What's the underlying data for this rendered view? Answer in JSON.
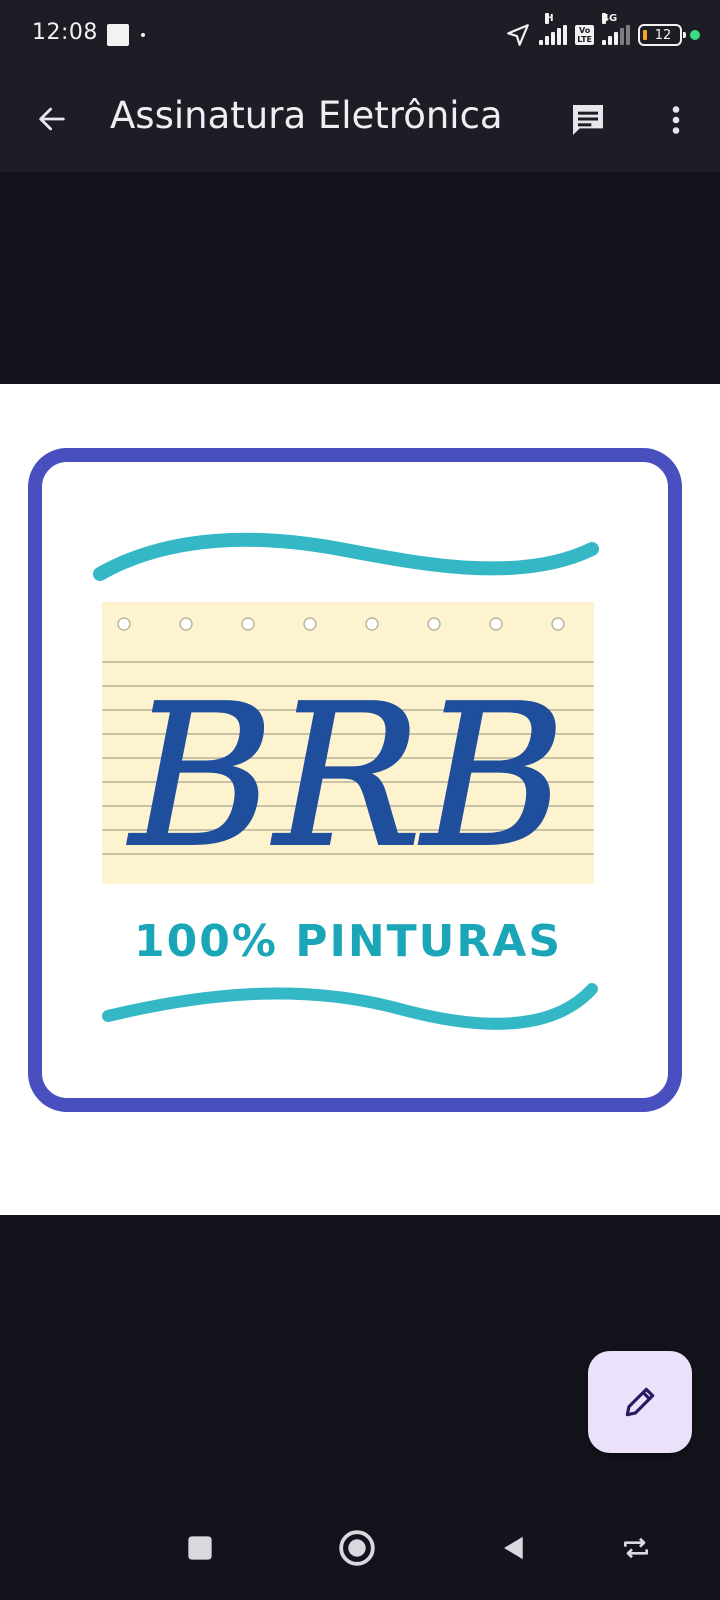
{
  "status_bar": {
    "time": "12:08",
    "network_h_label": "H",
    "volte_label_top": "Vo",
    "volte_label_bottom": "LTE",
    "network_4g_label": "4G",
    "battery_level": "12"
  },
  "app_bar": {
    "title": "Assinatura Eletrônica",
    "icons": [
      "back-arrow-icon",
      "comment-icon",
      "more-vert-icon"
    ]
  },
  "image": {
    "logo_letters": "BRB",
    "logo_tagline": "100% PINTURAS",
    "colors": {
      "frame": "#4a4fc0",
      "wave": "#35b8c6",
      "letters": "#1f4e9c",
      "paper": "#fdf3cf",
      "tagline": "#1aa6b6"
    }
  },
  "fab": {
    "icon": "edit-pencil-icon",
    "color": "#ece1fb"
  },
  "nav_bar": {
    "icons": [
      "recents-square-icon",
      "home-circle-icon",
      "back-triangle-icon",
      "rotate-icon"
    ]
  }
}
